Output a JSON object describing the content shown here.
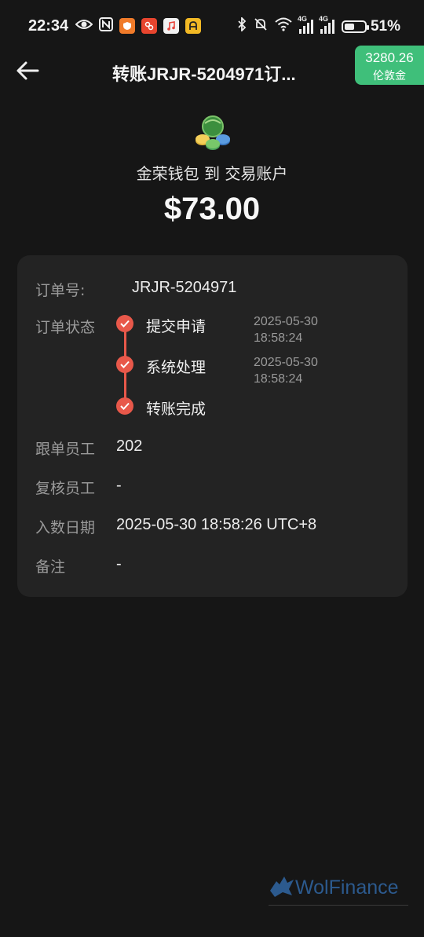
{
  "status_bar": {
    "time": "22:34",
    "battery_percent": "51%",
    "battery_level": 0.51,
    "network_1": "4G",
    "network_2": "4G",
    "left_icons": [
      "eye-icon",
      "nfc-icon",
      "shield-app-icon",
      "app-icon",
      "music-app-icon",
      "a-app-icon"
    ]
  },
  "header": {
    "title": "转账JRJR-5204971订...",
    "balance_value": "3280.26",
    "balance_label": "伦敦金",
    "balance_color": "#3fbf7a"
  },
  "summary": {
    "route": "金荣钱包 到 交易账户",
    "amount": "$73.00"
  },
  "details": {
    "order_no_label": "订单号:",
    "order_no": "JRJR-5204971",
    "status_label": "订单状态",
    "steps": [
      {
        "label": "提交申请",
        "date": "2025-05-30",
        "time": "18:58:24"
      },
      {
        "label": "系统处理",
        "date": "2025-05-30",
        "time": "18:58:24"
      },
      {
        "label": "转账完成",
        "date": "",
        "time": ""
      }
    ],
    "staff_label": "跟单员工",
    "staff": "202",
    "reviewer_label": "复核员工",
    "reviewer": "-",
    "deposit_date_label": "入数日期",
    "deposit_date": "2025-05-30 18:58:26 UTC+8",
    "remark_label": "备注",
    "remark": "-",
    "accent_color": "#e8584a"
  },
  "watermark": {
    "text": "WolFinance"
  }
}
